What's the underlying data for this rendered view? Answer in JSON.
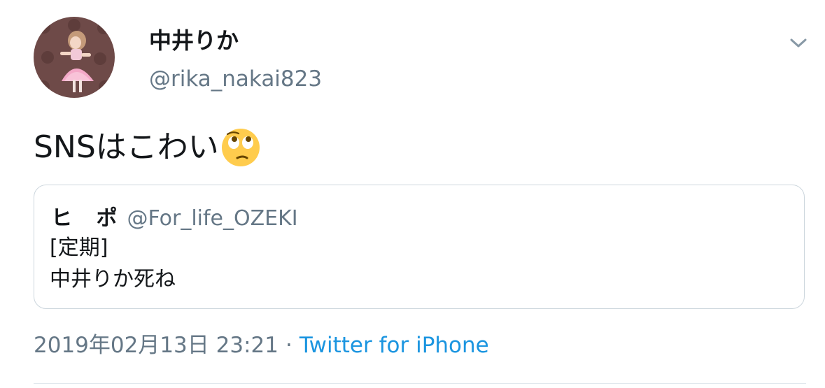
{
  "author": {
    "display_name": "中井りか",
    "handle": "@rika_nakai823",
    "avatar_icon": "profile-photo"
  },
  "menu_icon": "chevron-down-icon",
  "tweet": {
    "text": "SNSはこわい",
    "emoji": "face-with-rolling-eyes"
  },
  "quoted_tweet": {
    "display_name": "ヒ ポ",
    "handle": "@For_life_OZEKI",
    "line1": "[定期]",
    "line2": "中井りか死ね"
  },
  "meta": {
    "timestamp": "2019年02月13日 23:21",
    "separator": "·",
    "source": "Twitter for iPhone"
  },
  "colors": {
    "text": "#14171a",
    "secondary": "#657786",
    "link": "#1b95e0",
    "border": "#ccd6dd"
  }
}
